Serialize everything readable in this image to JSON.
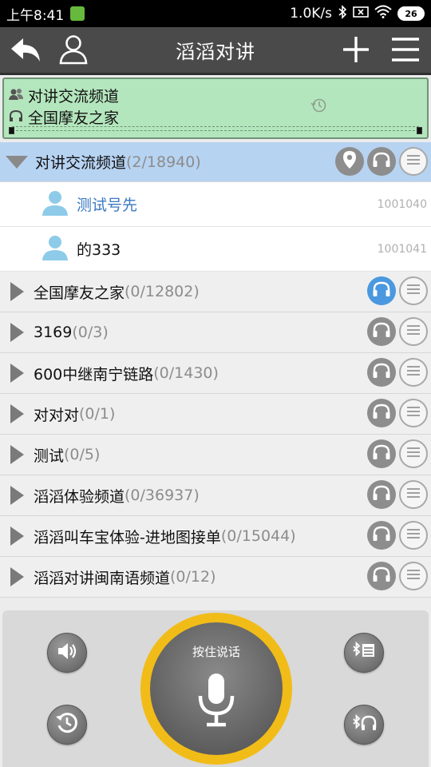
{
  "status_bar": {
    "time": "上午8:41",
    "speed": "1.0K/s",
    "battery": "26"
  },
  "header": {
    "title": "滔滔对讲"
  },
  "now_playing": {
    "line1": "对讲交流频道",
    "line2": "全国摩友之家"
  },
  "active_channel": {
    "name": "对讲交流频道",
    "count": "(2/18940)",
    "members": [
      {
        "name": "测试号先",
        "id": "1001040"
      },
      {
        "name": "的333",
        "id": "1001041"
      }
    ]
  },
  "channels": [
    {
      "name": "全国摩友之家",
      "count": "(0/12802)"
    },
    {
      "name": "3169",
      "count": "(0/3)"
    },
    {
      "name": "600中继南宁链路",
      "count": "(0/1430)"
    },
    {
      "name": "对对对",
      "count": "(0/1)"
    },
    {
      "name": "测试",
      "count": "(0/5)"
    },
    {
      "name": "滔滔体验频道",
      "count": "(0/36937)"
    },
    {
      "name": "滔滔叫车宝体验-进地图接单",
      "count": "(0/15044)"
    },
    {
      "name": "滔滔对讲闽南语频道",
      "count": "(0/12)"
    }
  ],
  "ptt": {
    "label": "按住说话"
  },
  "colors": {
    "accent_gold": "#f1bc18",
    "active_row": "#b7d3f2",
    "now_playing_bg": "#b4e6bd",
    "listen_blue": "#4a98e0"
  }
}
